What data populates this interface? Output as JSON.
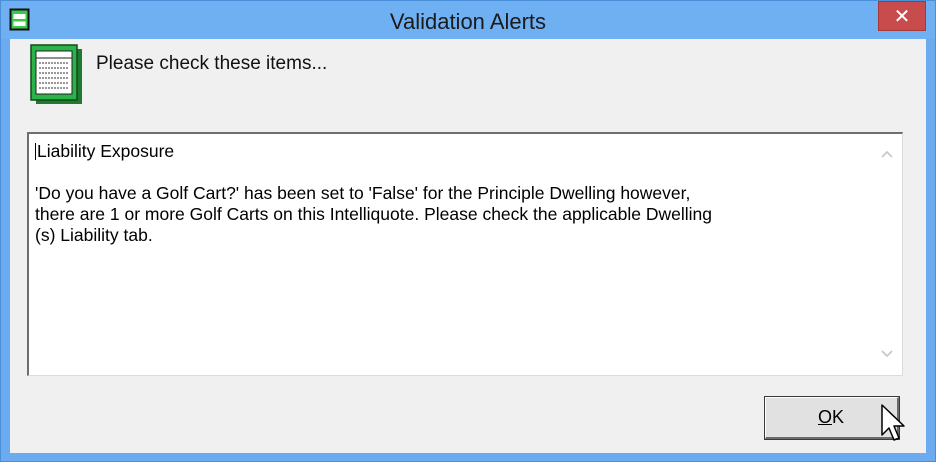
{
  "window": {
    "title": "Validation Alerts",
    "close_glyph": "✕"
  },
  "header": {
    "text": "Please check these items...",
    "icon": "document-list-icon"
  },
  "message": {
    "lines": [
      "Liability Exposure",
      "",
      "'Do you have a Golf Cart?' has been set to 'False' for the Principle Dwelling however,",
      "there are 1 or more Golf Carts on this Intelliquote. Please check the applicable Dwelling",
      "(s) Liability tab."
    ]
  },
  "buttons": {
    "ok_mnemonic": "O",
    "ok_rest": "K"
  },
  "colors": {
    "titlebar": "#6fb0f3",
    "close_button": "#c94c4c",
    "dialog_bg": "#f0f0f0",
    "icon_green": "#2bb34a"
  }
}
